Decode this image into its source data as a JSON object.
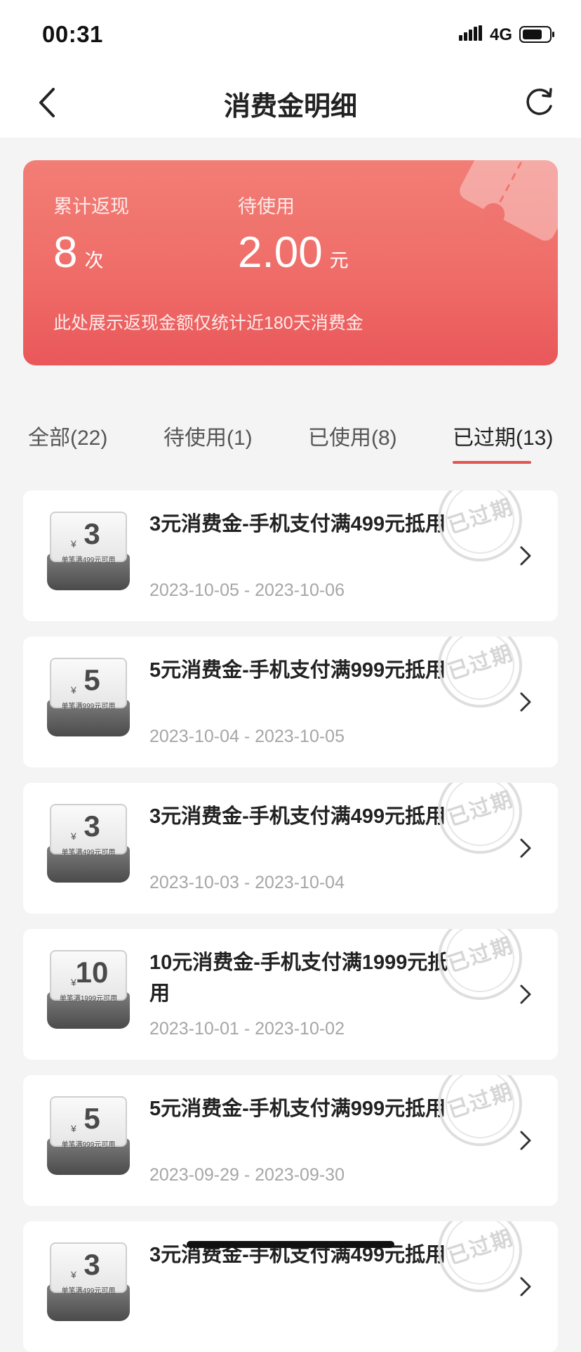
{
  "status_bar": {
    "time": "00:31",
    "network": "4G"
  },
  "header": {
    "title": "消费金明细"
  },
  "summary": {
    "cashback_label": "累计返现",
    "cashback_value": "8",
    "cashback_unit": "次",
    "pending_label": "待使用",
    "pending_value": "2.00",
    "pending_unit": "元",
    "note": "此处展示返现金额仅统计近180天消费金"
  },
  "tabs": [
    {
      "label": "全部(22)"
    },
    {
      "label": "待使用(1)"
    },
    {
      "label": "已使用(8)"
    },
    {
      "label": "已过期(13)",
      "active": true
    }
  ],
  "items": [
    {
      "amount": "3",
      "currency": "¥",
      "condition": "单笔满499元可用",
      "title": "3元消费金-手机支付满499元抵用",
      "dates": "2023-10-05 - 2023-10-06",
      "stamp": "已过期"
    },
    {
      "amount": "5",
      "currency": "¥",
      "condition": "单笔满999元可用",
      "title": "5元消费金-手机支付满999元抵用",
      "dates": "2023-10-04 - 2023-10-05",
      "stamp": "已过期"
    },
    {
      "amount": "3",
      "currency": "¥",
      "condition": "单笔满499元可用",
      "title": "3元消费金-手机支付满499元抵用",
      "dates": "2023-10-03 - 2023-10-04",
      "stamp": "已过期"
    },
    {
      "amount": "10",
      "currency": "¥",
      "condition": "单笔满1999元可用",
      "title": "10元消费金-手机支付满1999元抵用",
      "dates": "2023-10-01 - 2023-10-02",
      "stamp": "已过期"
    },
    {
      "amount": "5",
      "currency": "¥",
      "condition": "单笔满999元可用",
      "title": "5元消费金-手机支付满999元抵用",
      "dates": "2023-09-29 - 2023-09-30",
      "stamp": "已过期"
    },
    {
      "amount": "3",
      "currency": "¥",
      "condition": "单笔满499元可用",
      "title": "3元消费金-手机支付满499元抵用",
      "dates": "",
      "stamp": "已过期"
    }
  ],
  "colors": {
    "accent": "#e25450",
    "card_top": "#f27e76",
    "card_bottom": "#e9575a",
    "muted_text": "#a6a6a6"
  },
  "icons": [
    "back-arrow-icon",
    "refresh-icon",
    "chevron-right-icon",
    "signal-icon",
    "battery-icon"
  ]
}
